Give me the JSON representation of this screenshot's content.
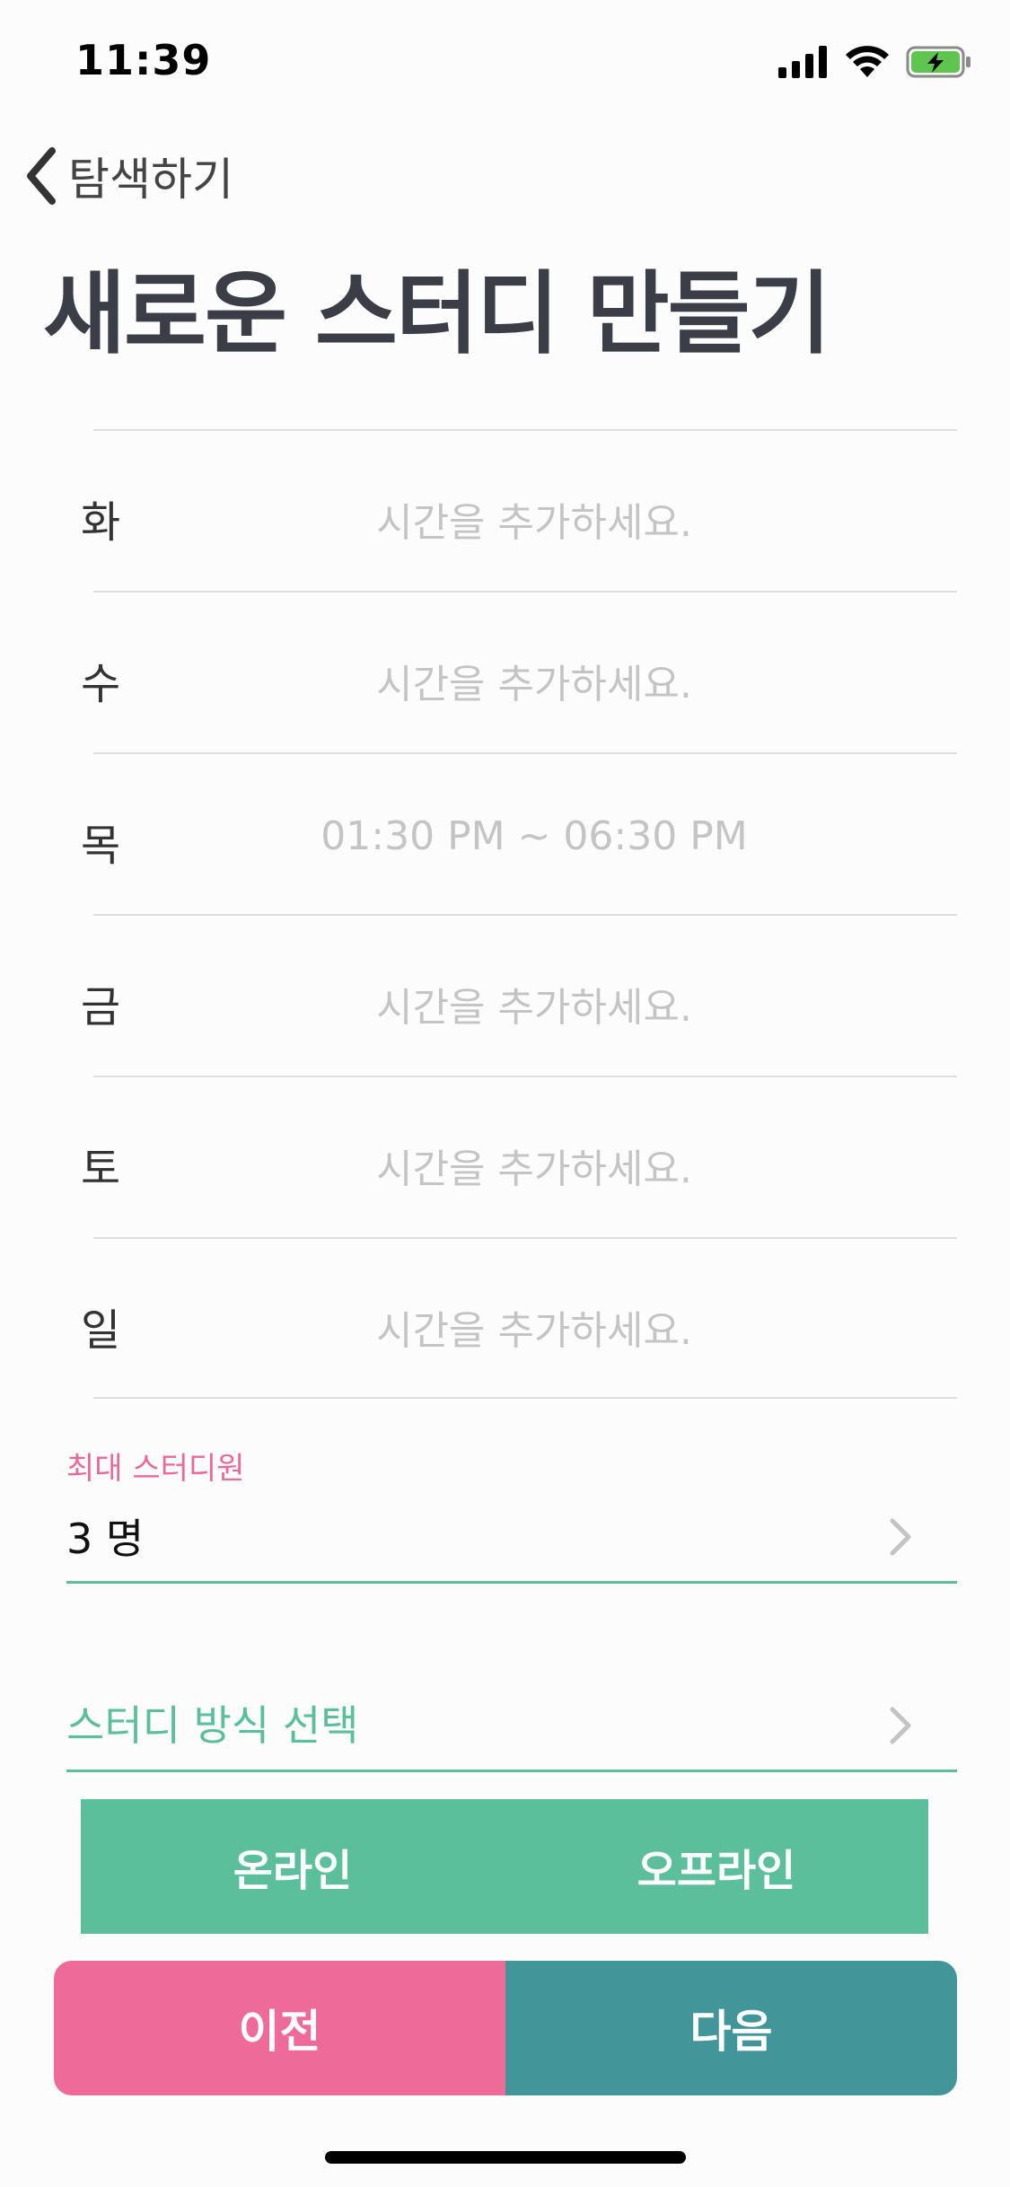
{
  "status_bar": {
    "time": "11:39",
    "icons": [
      "signal-icon",
      "wifi-icon",
      "battery-charging-icon"
    ],
    "battery_color": "#5ec64f"
  },
  "nav": {
    "back_label": "탐색하기",
    "back_icon": "chevron-left-icon"
  },
  "page_title": "새로운 스터디 만들기",
  "days": [
    {
      "day": "화",
      "time": "시간을 추가하세요."
    },
    {
      "day": "수",
      "time": "시간을 추가하세요."
    },
    {
      "day": "목",
      "time": "01:30 PM ~ 06:30 PM"
    },
    {
      "day": "금",
      "time": "시간을 추가하세요."
    },
    {
      "day": "토",
      "time": "시간을 추가하세요."
    },
    {
      "day": "일",
      "time": "시간을 추가하세요."
    }
  ],
  "max_members": {
    "label": "최대 스터디원",
    "value": "3 명"
  },
  "study_method": {
    "label": "스터디 방식 선택",
    "options": [
      "온라인",
      "오프라인"
    ]
  },
  "buttons": {
    "prev": "이전",
    "next": "다음"
  },
  "colors": {
    "accent_green": "#5bbf9c",
    "accent_pink": "#ee6a98",
    "accent_teal": "#429599",
    "title": "#3b3e47",
    "placeholder": "#c4c4c4"
  }
}
